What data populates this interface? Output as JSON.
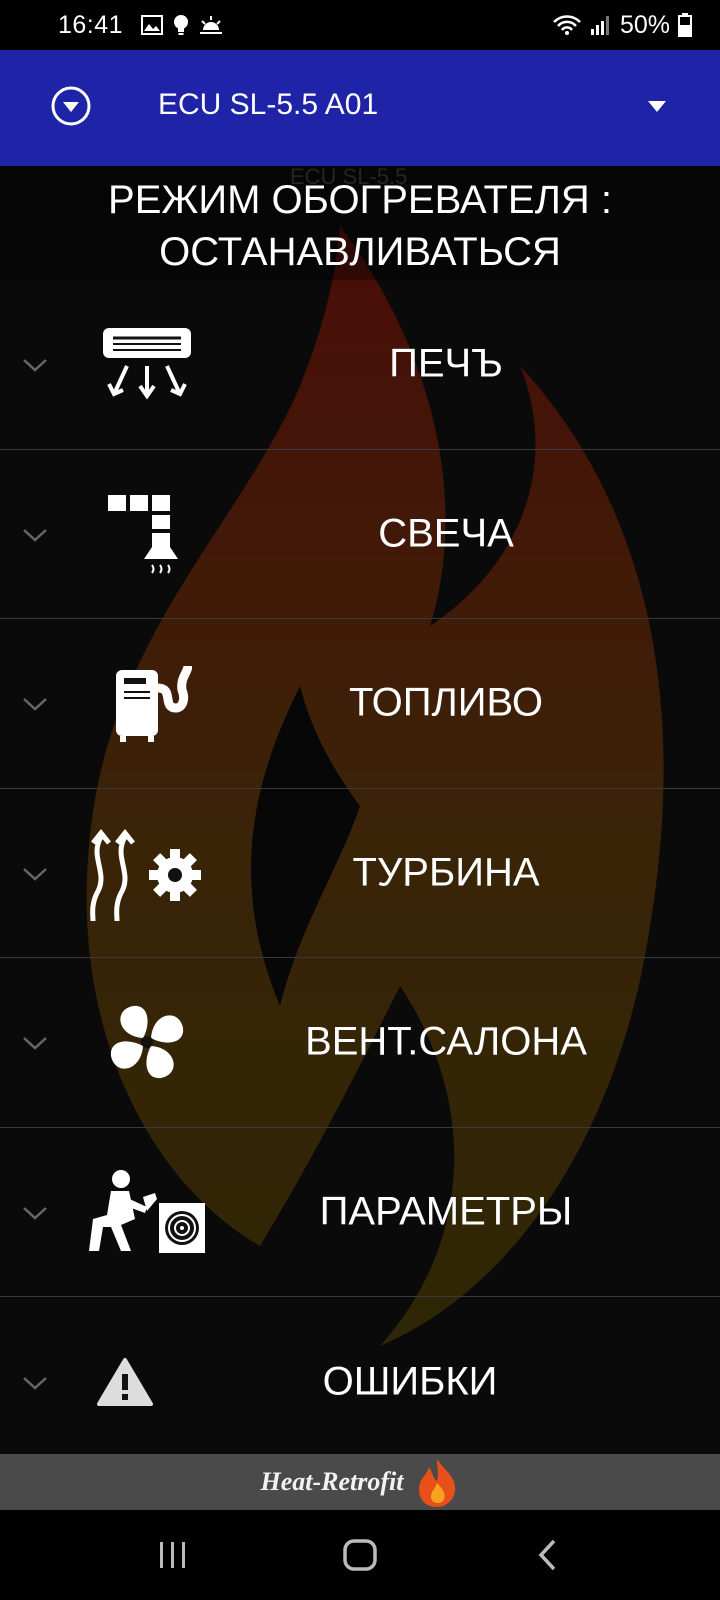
{
  "status_bar": {
    "time": "16:41",
    "battery": "50%",
    "icons": [
      "gallery-icon",
      "bulb-icon",
      "sunrise-icon",
      "wifi-icon",
      "signal-icon",
      "battery-icon"
    ]
  },
  "app_bar": {
    "title": "ECU SL-5.5 A01",
    "ghost_label": "ECU SL-5.5",
    "color": "#1e23a8"
  },
  "mode": {
    "line1": "РЕЖИМ ОБОГРЕВАТЕЛЯ :",
    "line2": "ОСТАНАВЛИВАТЬСЯ"
  },
  "menu": {
    "items": [
      {
        "label": "ПЕЧЪ",
        "icon": "air-conditioner-icon"
      },
      {
        "label": "СВЕЧА",
        "icon": "glow-plug-icon"
      },
      {
        "label": "ТОПЛИВО",
        "icon": "fuel-heater-icon"
      },
      {
        "label": "ТУРБИНА",
        "icon": "turbine-heat-gear-icon"
      },
      {
        "label": "ВЕНТ.САЛОНА",
        "icon": "fan-icon"
      },
      {
        "label": "ПАРАМЕТРЫ",
        "icon": "technician-icon"
      },
      {
        "label": "ОШИБКИ",
        "icon": "warning-icon"
      }
    ]
  },
  "footer": {
    "brand": "Heat-Retrofit"
  },
  "nav_bar": {
    "buttons": [
      "recent-apps-icon",
      "home-icon",
      "back-icon"
    ]
  }
}
